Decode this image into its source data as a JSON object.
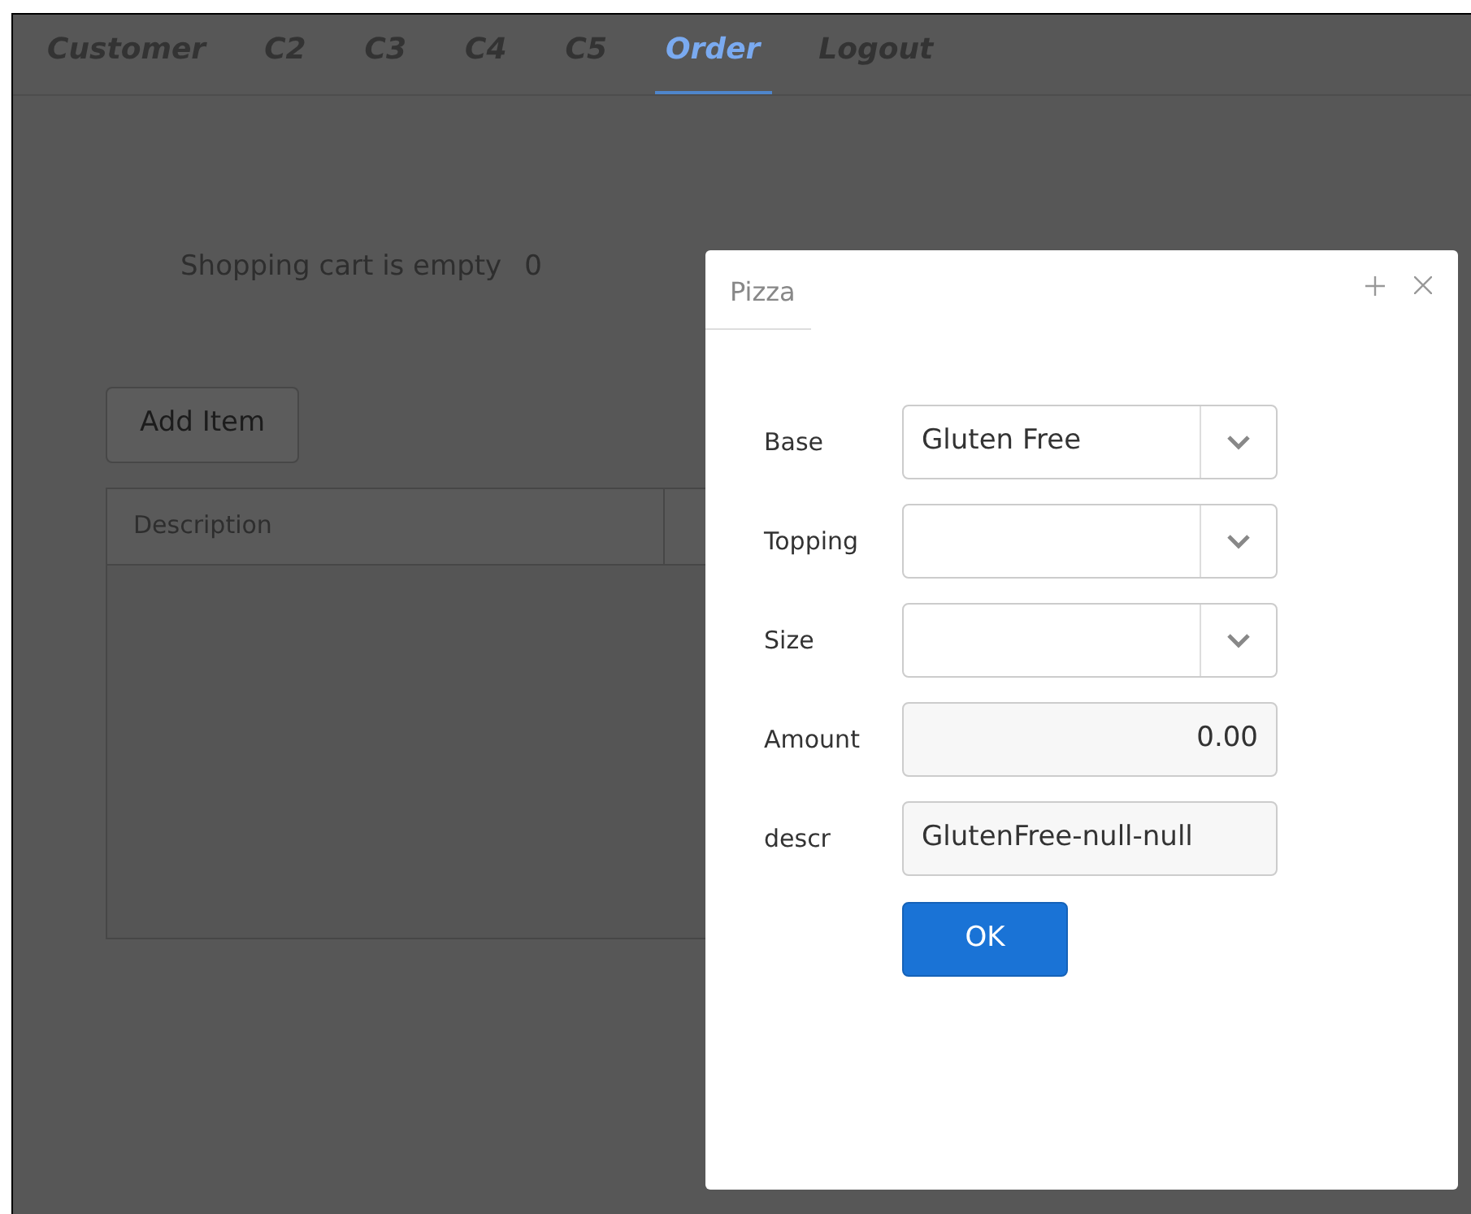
{
  "tabs": [
    {
      "label": "Customer",
      "selected": false
    },
    {
      "label": "C2",
      "selected": false
    },
    {
      "label": "C3",
      "selected": false
    },
    {
      "label": "C4",
      "selected": false
    },
    {
      "label": "C5",
      "selected": false
    },
    {
      "label": "Order",
      "selected": true
    },
    {
      "label": "Logout",
      "selected": false
    }
  ],
  "cart": {
    "message": "Shopping cart is empty",
    "count": "0"
  },
  "add_button": "Add Item",
  "table": {
    "columns": [
      "Description"
    ]
  },
  "dialog": {
    "title": "Pizza",
    "fields": [
      {
        "label": "Base",
        "kind": "select",
        "value": "Gluten Free"
      },
      {
        "label": "Topping",
        "kind": "select"
      },
      {
        "label": "Size",
        "kind": "select"
      },
      {
        "label": "Amount",
        "kind": "number",
        "value": "0.00"
      },
      {
        "label": "descr",
        "kind": "text",
        "value": "GlutenFree-null-null"
      }
    ],
    "ok_button": "OK"
  }
}
